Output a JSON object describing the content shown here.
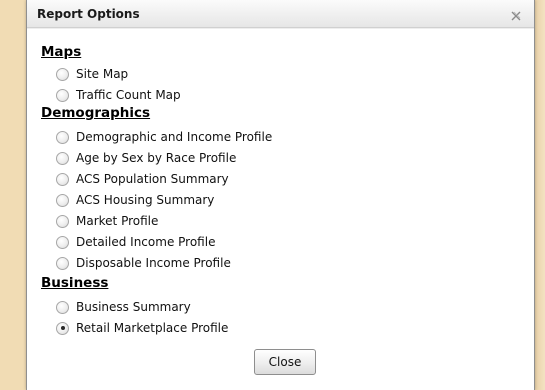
{
  "dialog": {
    "title": "Report Options",
    "close_label": "Close"
  },
  "sections": [
    {
      "heading": "Maps",
      "options": [
        {
          "label": "Site Map",
          "selected": false
        },
        {
          "label": "Traffic Count Map",
          "selected": false
        }
      ]
    },
    {
      "heading": "Demographics",
      "options": [
        {
          "label": "Demographic and Income Profile",
          "selected": false
        },
        {
          "label": "Age by Sex by Race Profile",
          "selected": false
        },
        {
          "label": "ACS Population Summary",
          "selected": false
        },
        {
          "label": "ACS Housing Summary",
          "selected": false
        },
        {
          "label": "Market Profile",
          "selected": false
        },
        {
          "label": "Detailed Income Profile",
          "selected": false
        },
        {
          "label": "Disposable Income Profile",
          "selected": false
        }
      ]
    },
    {
      "heading": "Business",
      "options": [
        {
          "label": "Business Summary",
          "selected": false
        },
        {
          "label": "Retail Marketplace Profile",
          "selected": true
        }
      ]
    }
  ],
  "icons": {
    "close": "close-icon",
    "radio": "radio-icon"
  }
}
